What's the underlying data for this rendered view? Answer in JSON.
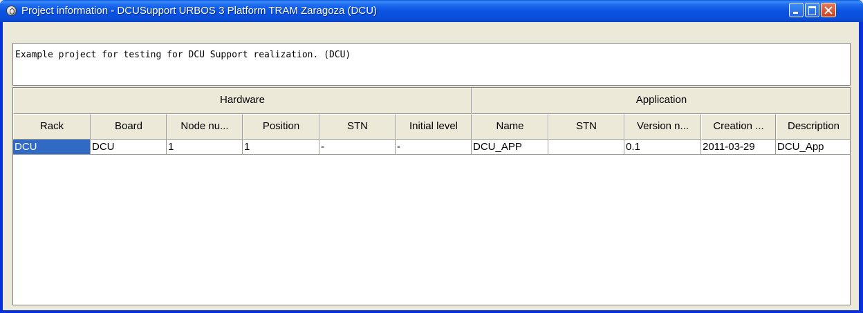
{
  "window": {
    "title": "Project information - DCUSupport URBOS 3 Platform TRAM Zaragoza (DCU)",
    "icon": "app-icon",
    "controls": [
      "minimize",
      "maximize",
      "close"
    ]
  },
  "description": "Example project for testing for DCU Support realization. (DCU)",
  "table": {
    "groups": [
      "Hardware",
      "Application"
    ],
    "columns": [
      "Rack",
      "Board",
      "Node nu...",
      "Position",
      "STN",
      "Initial level",
      "Name",
      "STN",
      "Version n...",
      "Creation ...",
      "Description"
    ],
    "rows": [
      [
        "DCU",
        "DCU",
        "1",
        "1",
        "-",
        "-",
        "DCU_APP",
        "",
        "0.1",
        "2011-03-29",
        "DCU_App"
      ]
    ],
    "selected_cell": "Rack"
  },
  "colors": {
    "titlebar": "#0a53e0",
    "selection": "#316ac5",
    "window_bg": "#ece9d8"
  }
}
